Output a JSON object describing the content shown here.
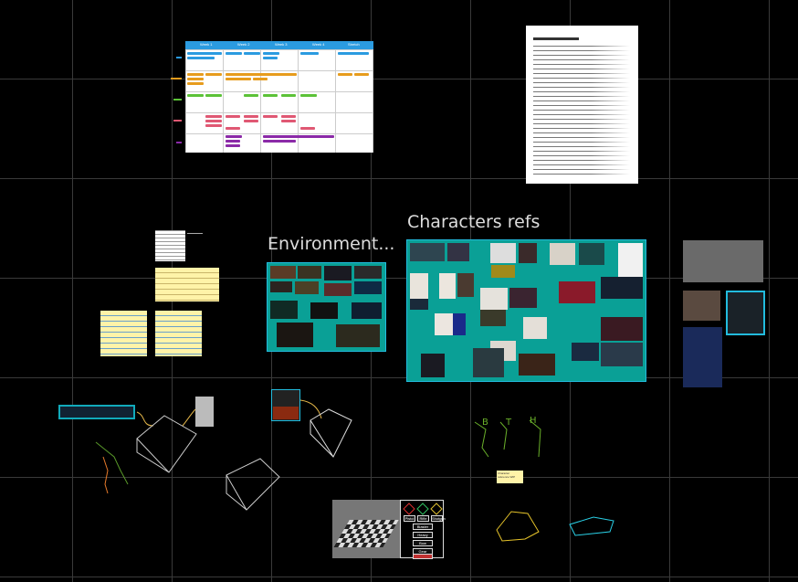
{
  "boards": {
    "environment_title": "Environment...",
    "characters_title": "Characters refs"
  },
  "schedule": {
    "headers": [
      "Week 1",
      "Week 2",
      "Week 3",
      "Week 4",
      "Stretch"
    ],
    "colors": {
      "header": "#2b9be0",
      "blue": "#2b9be0",
      "orange": "#e79c1d",
      "green": "#5cc238",
      "pink": "#e05873",
      "purple": "#8b2aa8"
    }
  },
  "sticky_notes": {
    "small_note_label": "Character\nreference WIP"
  },
  "menu_mockup": {
    "options": [
      "Pistol",
      "Rifle",
      "Shotgun",
      "Blaster",
      "Heavy",
      "Bow",
      "Gear"
    ]
  },
  "sketch_labels": [
    "B",
    "T",
    "H"
  ],
  "icons": {
    "grid": "canvas-grid",
    "arrow": "connector-arrow"
  }
}
